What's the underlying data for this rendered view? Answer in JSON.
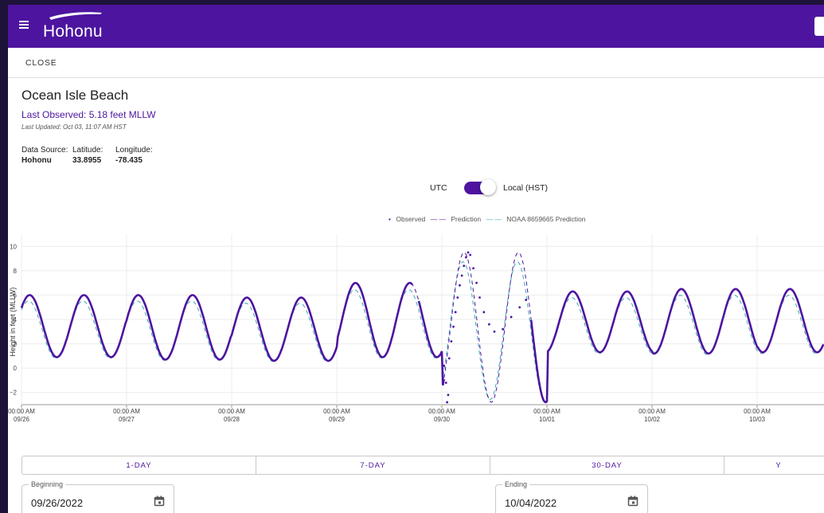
{
  "app": {
    "brand": "Hohonu"
  },
  "toolbar": {
    "close_label": "CLOSE"
  },
  "station": {
    "title": "Ocean Isle Beach",
    "last_observed": "Last Observed: 5.18 feet MLLW",
    "last_updated": "Last Updated: Oct 03, 11:07 AM HST",
    "meta": [
      {
        "label": "Data Source:",
        "value": "Hohonu"
      },
      {
        "label": "Latitude:",
        "value": "33.8955"
      },
      {
        "label": "Longitude:",
        "value": "-78.435"
      }
    ]
  },
  "timezone": {
    "left": "UTC",
    "right": "Local (HST)",
    "selected": "Local (HST)"
  },
  "colors": {
    "brand": "#4d149f",
    "prediction": "#4d149f",
    "noaa": "#3aa7b3"
  },
  "chart_data": {
    "type": "line",
    "ylabel": "Height in feet (MLLW)",
    "ylim": [
      -3,
      11
    ],
    "yticks": [
      "−2",
      "0",
      "2",
      "4",
      "6",
      "8",
      "10"
    ],
    "xticks": [
      {
        "time": "00:00 AM",
        "date": "09/26"
      },
      {
        "time": "00:00 AM",
        "date": "09/27"
      },
      {
        "time": "00:00 AM",
        "date": "09/28"
      },
      {
        "time": "00:00 AM",
        "date": "09/29"
      },
      {
        "time": "00:00 AM",
        "date": "09/30"
      },
      {
        "time": "00:00 AM",
        "date": "10/01"
      },
      {
        "time": "00:00 AM",
        "date": "10/02"
      },
      {
        "time": "00:00 AM",
        "date": "10/03"
      }
    ],
    "series": [
      {
        "name": "Observed",
        "style": "dots"
      },
      {
        "name": "Prediction",
        "style": "dashed"
      },
      {
        "name": "NOAA 8659665 Prediction",
        "style": "dashed"
      }
    ],
    "tide_cycle_days": [
      {
        "day": "09/26",
        "high": 6.0,
        "low": 0.9
      },
      {
        "day": "09/27",
        "high": 6.0,
        "low": 0.7
      },
      {
        "day": "09/28",
        "high": 5.8,
        "low": 0.6
      },
      {
        "day": "09/29",
        "high": 7.0,
        "low": 0.9
      },
      {
        "day": "09/30",
        "high": 9.5,
        "low": -2.8
      },
      {
        "day": "10/01",
        "high": 6.3,
        "low": 1.3
      },
      {
        "day": "10/02",
        "high": 6.5,
        "low": 1.2
      },
      {
        "day": "10/03",
        "high": 6.5,
        "low": 1.3
      }
    ]
  },
  "range_buttons": [
    "1-DAY",
    "7-DAY",
    "30-DAY",
    "Y"
  ],
  "dates": {
    "beginning_label": "Beginning",
    "beginning_value": "09/26/2022",
    "ending_label": "Ending",
    "ending_value": "10/04/2022"
  }
}
